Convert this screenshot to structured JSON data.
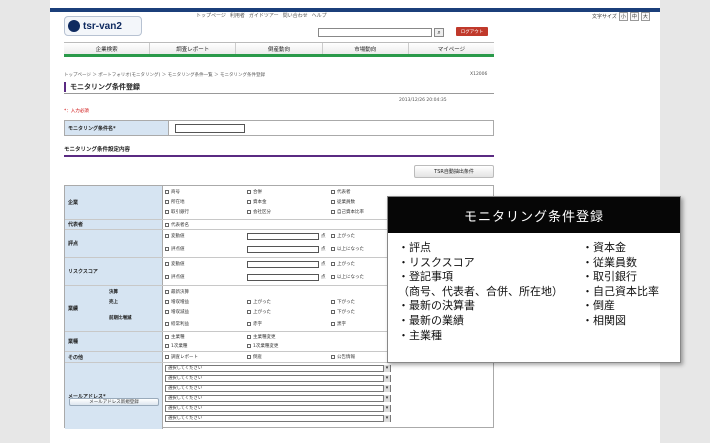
{
  "header": {
    "logo_text": "tsr-van2",
    "util_links": [
      "トップページ",
      "利用者",
      "ガイドツアー",
      "問い合わせ",
      "ヘルプ"
    ],
    "font_size_label": "文字サイズ",
    "font_sizes": [
      "小",
      "中",
      "大"
    ],
    "logout_label": "ログアウト"
  },
  "nav": [
    "企業検索",
    "調査レポート",
    "倒産動向",
    "市場動向",
    "マイページ"
  ],
  "breadcrumb": "トップページ ＞ ポートフォリオ(モニタリング) ＞ モニタリング条件一覧 ＞ モニタリング条件登録",
  "ref_id": "X12006",
  "page_title": "モニタリング条件登録",
  "datetime": "2013/12/26 20:04:35",
  "required_note": "*：入力必須",
  "name_label": "モニタリング条件名*",
  "section_title": "モニタリング条件設定内容",
  "tsr_button": "TSR自動抽出条件",
  "conditions": {
    "company": {
      "label": "企業",
      "options": [
        "商号",
        "合併",
        "代表者",
        "所在地",
        "資本金",
        "従業員数",
        "取引銀行",
        "会社区分",
        "自己資本比率"
      ]
    },
    "rep": {
      "label": "代表者",
      "option": "代表者名"
    },
    "rating": {
      "label": "評点",
      "options": [
        "変動値",
        "評点値"
      ],
      "suffix": "点",
      "up": "上がった",
      "above": "以上になった"
    },
    "risk": {
      "label": "リスクスコア",
      "options": [
        "変動値",
        "評点値"
      ],
      "suffix": "点",
      "up": "上がった",
      "above": "以上になった"
    },
    "perf": {
      "label": "業績",
      "sub": [
        "決算",
        "売上",
        "前期比増減"
      ],
      "options": [
        "最新決算",
        "増収増益",
        "増収減益",
        "経常利益",
        "増収減益",
        "減収減益",
        "上がった",
        "上がった",
        "下がった",
        "下がった",
        "赤字",
        "黒字",
        "下がった"
      ]
    },
    "biz_type": {
      "label": "業種",
      "options": [
        "主業種",
        "主業種変更",
        "1次業種",
        "1次業種変更"
      ]
    },
    "other": {
      "label": "その他",
      "options": [
        "調査レポート",
        "倒産",
        "公告情報"
      ]
    },
    "mail": {
      "label": "メールアドレス*",
      "select_value": "選択してください",
      "new_button": "メールアドレス新規登録"
    }
  },
  "popup": {
    "title": "モニタリング条件登録",
    "left_items": [
      "・評点",
      "・リスクスコア",
      "・登記事項",
      "（商号、代表者、合併、所在地）",
      "・最新の決算書",
      "・最新の業績",
      "・主業種"
    ],
    "right_items": [
      "・資本金",
      "・従業員数",
      "・取引銀行",
      "・自己資本比率",
      "・倒産",
      "・相関図"
    ]
  }
}
